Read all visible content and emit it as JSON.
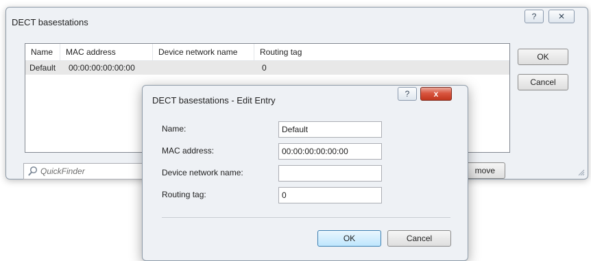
{
  "main_window": {
    "title": "DECT basestations",
    "help_glyph": "?",
    "close_glyph": "✕",
    "columns": [
      "Name",
      "MAC address",
      "Device network name",
      "Routing tag"
    ],
    "rows": [
      {
        "name": "Default",
        "mac": "00:00:00:00:00:00",
        "device": "",
        "routing": "0"
      }
    ],
    "ok_label": "OK",
    "cancel_label": "Cancel",
    "quickfinder_placeholder": "QuickFinder",
    "remove_label_visible": "move"
  },
  "edit_dialog": {
    "title": "DECT basestations - Edit Entry",
    "help_glyph": "?",
    "close_glyph": "x",
    "fields": {
      "name_label": "Name:",
      "name_value": "Default",
      "mac_label": "MAC address:",
      "mac_value": "00:00:00:00:00:00",
      "device_label": "Device network name:",
      "device_value": "",
      "routing_label": "Routing tag:",
      "routing_value": "0"
    },
    "ok_label": "OK",
    "cancel_label": "Cancel"
  }
}
